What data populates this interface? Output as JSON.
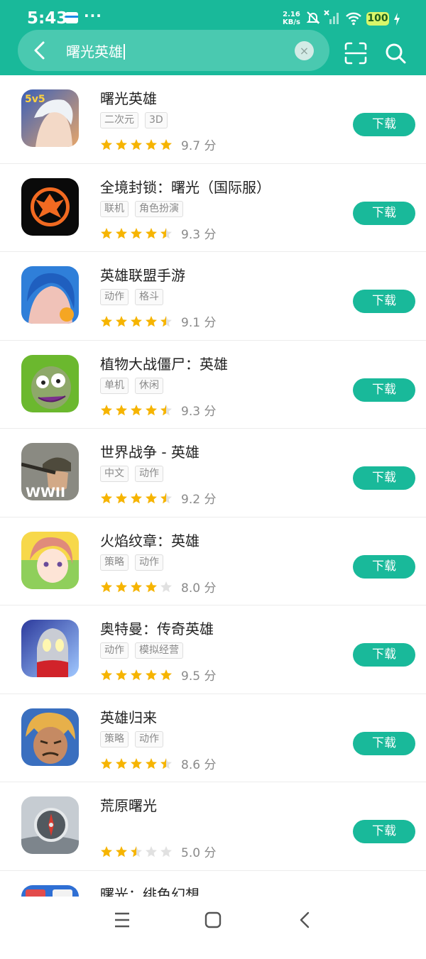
{
  "status_bar": {
    "time": "5:43",
    "dots": "···",
    "net_speed_value": "2.16",
    "net_speed_unit": "KB/s",
    "battery": "100"
  },
  "search": {
    "query": "曙光英雄",
    "clear_symbol": "×"
  },
  "colors": {
    "brand": "#19b99a",
    "star_on": "#f6b400",
    "star_off": "#e1e1e1"
  },
  "results": [
    {
      "name": "曙光英雄",
      "tags": [
        "二次元",
        "3D"
      ],
      "rating": 5,
      "score": "9.7 分",
      "button": "下载",
      "icon": "hero-portrait-icon"
    },
    {
      "name": "全境封锁：曙光（国际服）",
      "tags": [
        "联机",
        "角色扮演"
      ],
      "rating": 4.5,
      "score": "9.3 分",
      "button": "下载",
      "icon": "phoenix-emblem-icon"
    },
    {
      "name": "英雄联盟手游",
      "tags": [
        "动作",
        "格斗"
      ],
      "rating": 4.5,
      "score": "9.1 分",
      "button": "下载",
      "icon": "jinx-portrait-icon"
    },
    {
      "name": "植物大战僵尸：英雄",
      "tags": [
        "单机",
        "休闲"
      ],
      "rating": 4.5,
      "score": "9.3 分",
      "button": "下载",
      "icon": "zombie-face-icon"
    },
    {
      "name": "世界战争 - 英雄",
      "tags": [
        "中文",
        "动作"
      ],
      "rating": 4.5,
      "score": "9.2 分",
      "button": "下载",
      "icon": "soldier-wwii-icon"
    },
    {
      "name": "火焰纹章：英雄",
      "tags": [
        "策略",
        "动作"
      ],
      "rating": 4,
      "score": "8.0 分",
      "button": "下载",
      "icon": "anime-girl-icon"
    },
    {
      "name": "奥特曼：传奇英雄",
      "tags": [
        "动作",
        "模拟经营"
      ],
      "rating": 5,
      "score": "9.5 分",
      "button": "下载",
      "icon": "ultraman-icon"
    },
    {
      "name": "英雄归来",
      "tags": [
        "策略",
        "动作"
      ],
      "rating": 4.5,
      "score": "8.6 分",
      "button": "下载",
      "icon": "warrior-face-icon"
    },
    {
      "name": "荒原曙光",
      "tags": [],
      "rating": 2.5,
      "score": "5.0 分",
      "button": "下载",
      "icon": "compass-hand-icon"
    },
    {
      "name": "曙光：绯色幻想",
      "tags": [],
      "rating": 0,
      "score": "",
      "button": "",
      "icon": "cards-icon"
    }
  ]
}
